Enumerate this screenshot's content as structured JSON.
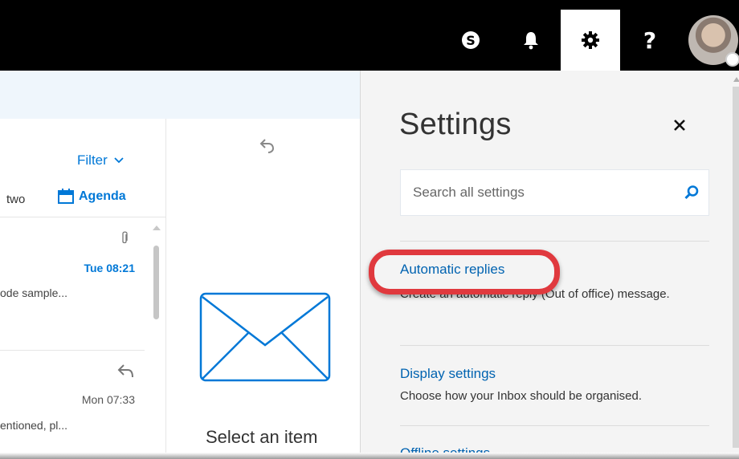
{
  "topbar": {
    "icons": [
      "skype-icon",
      "bell-icon",
      "gear-icon",
      "help-icon",
      "avatar"
    ],
    "help_glyph": "?"
  },
  "mail_list": {
    "filter_label": "Filter",
    "view_label": "two",
    "agenda_label": "Agenda",
    "messages": [
      {
        "time": "Tue 08:21",
        "preview": "ode sample...",
        "has_attachment": true
      },
      {
        "time": "Mon 07:33",
        "preview": "entioned, pl...",
        "replied": true
      }
    ]
  },
  "reading_pane": {
    "empty_text": "Select an item"
  },
  "settings": {
    "title": "Settings",
    "search_placeholder": "Search all settings",
    "items": [
      {
        "title": "Automatic replies",
        "description": "Create an automatic reply (Out of office) message."
      },
      {
        "title": "Display settings",
        "description": "Choose how your Inbox should be organised."
      },
      {
        "title": "Offline settings",
        "description": ""
      }
    ]
  },
  "colors": {
    "topbar": "#000000",
    "accent": "#0078d7",
    "link": "#0063b1",
    "highlight": "#e0393e",
    "panel_bg": "#f4f4f4"
  }
}
